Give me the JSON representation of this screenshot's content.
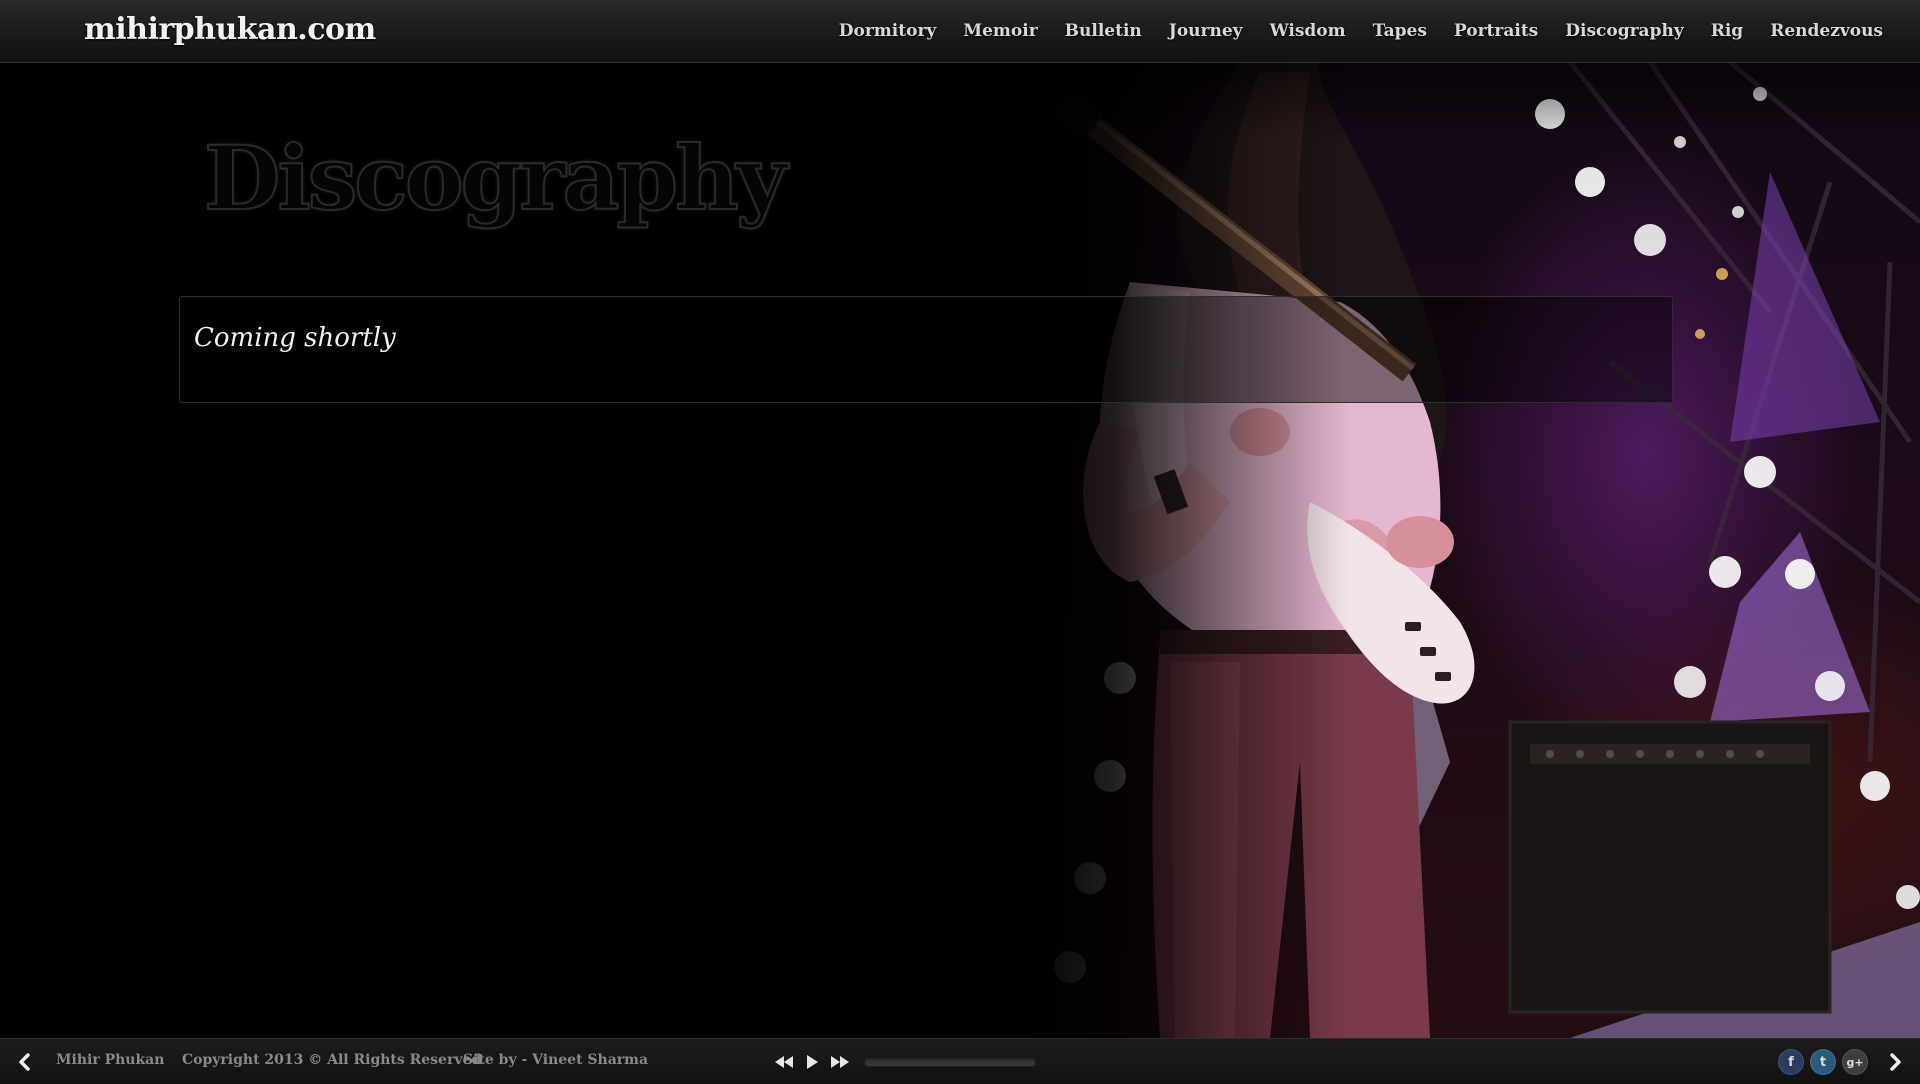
{
  "header": {
    "logo": "mihirphukan.com",
    "nav": [
      {
        "label": "Dormitory"
      },
      {
        "label": "Memoir"
      },
      {
        "label": "Bulletin"
      },
      {
        "label": "Journey"
      },
      {
        "label": "Wisdom"
      },
      {
        "label": "Tapes"
      },
      {
        "label": "Portraits"
      },
      {
        "label": "Discography"
      },
      {
        "label": "Rig"
      },
      {
        "label": "Rendezvous"
      }
    ]
  },
  "main": {
    "title": "Discography",
    "content": "Coming shortly"
  },
  "footer": {
    "name": "Mihir Phukan",
    "copyright": "Copyright 2013 © All Rights Reserved",
    "site_by": "Site by - Vineet Sharma",
    "player": {
      "progress": 0
    },
    "social": [
      {
        "icon": "facebook-icon",
        "glyph": "f"
      },
      {
        "icon": "twitter-icon",
        "glyph": "t"
      },
      {
        "icon": "google-plus-icon",
        "glyph": "g+"
      }
    ]
  },
  "colors": {
    "background": "#000000",
    "bar": "#1a1a1a",
    "nav_text": "#d8d8d8",
    "footer_text": "#8a8a8a"
  }
}
